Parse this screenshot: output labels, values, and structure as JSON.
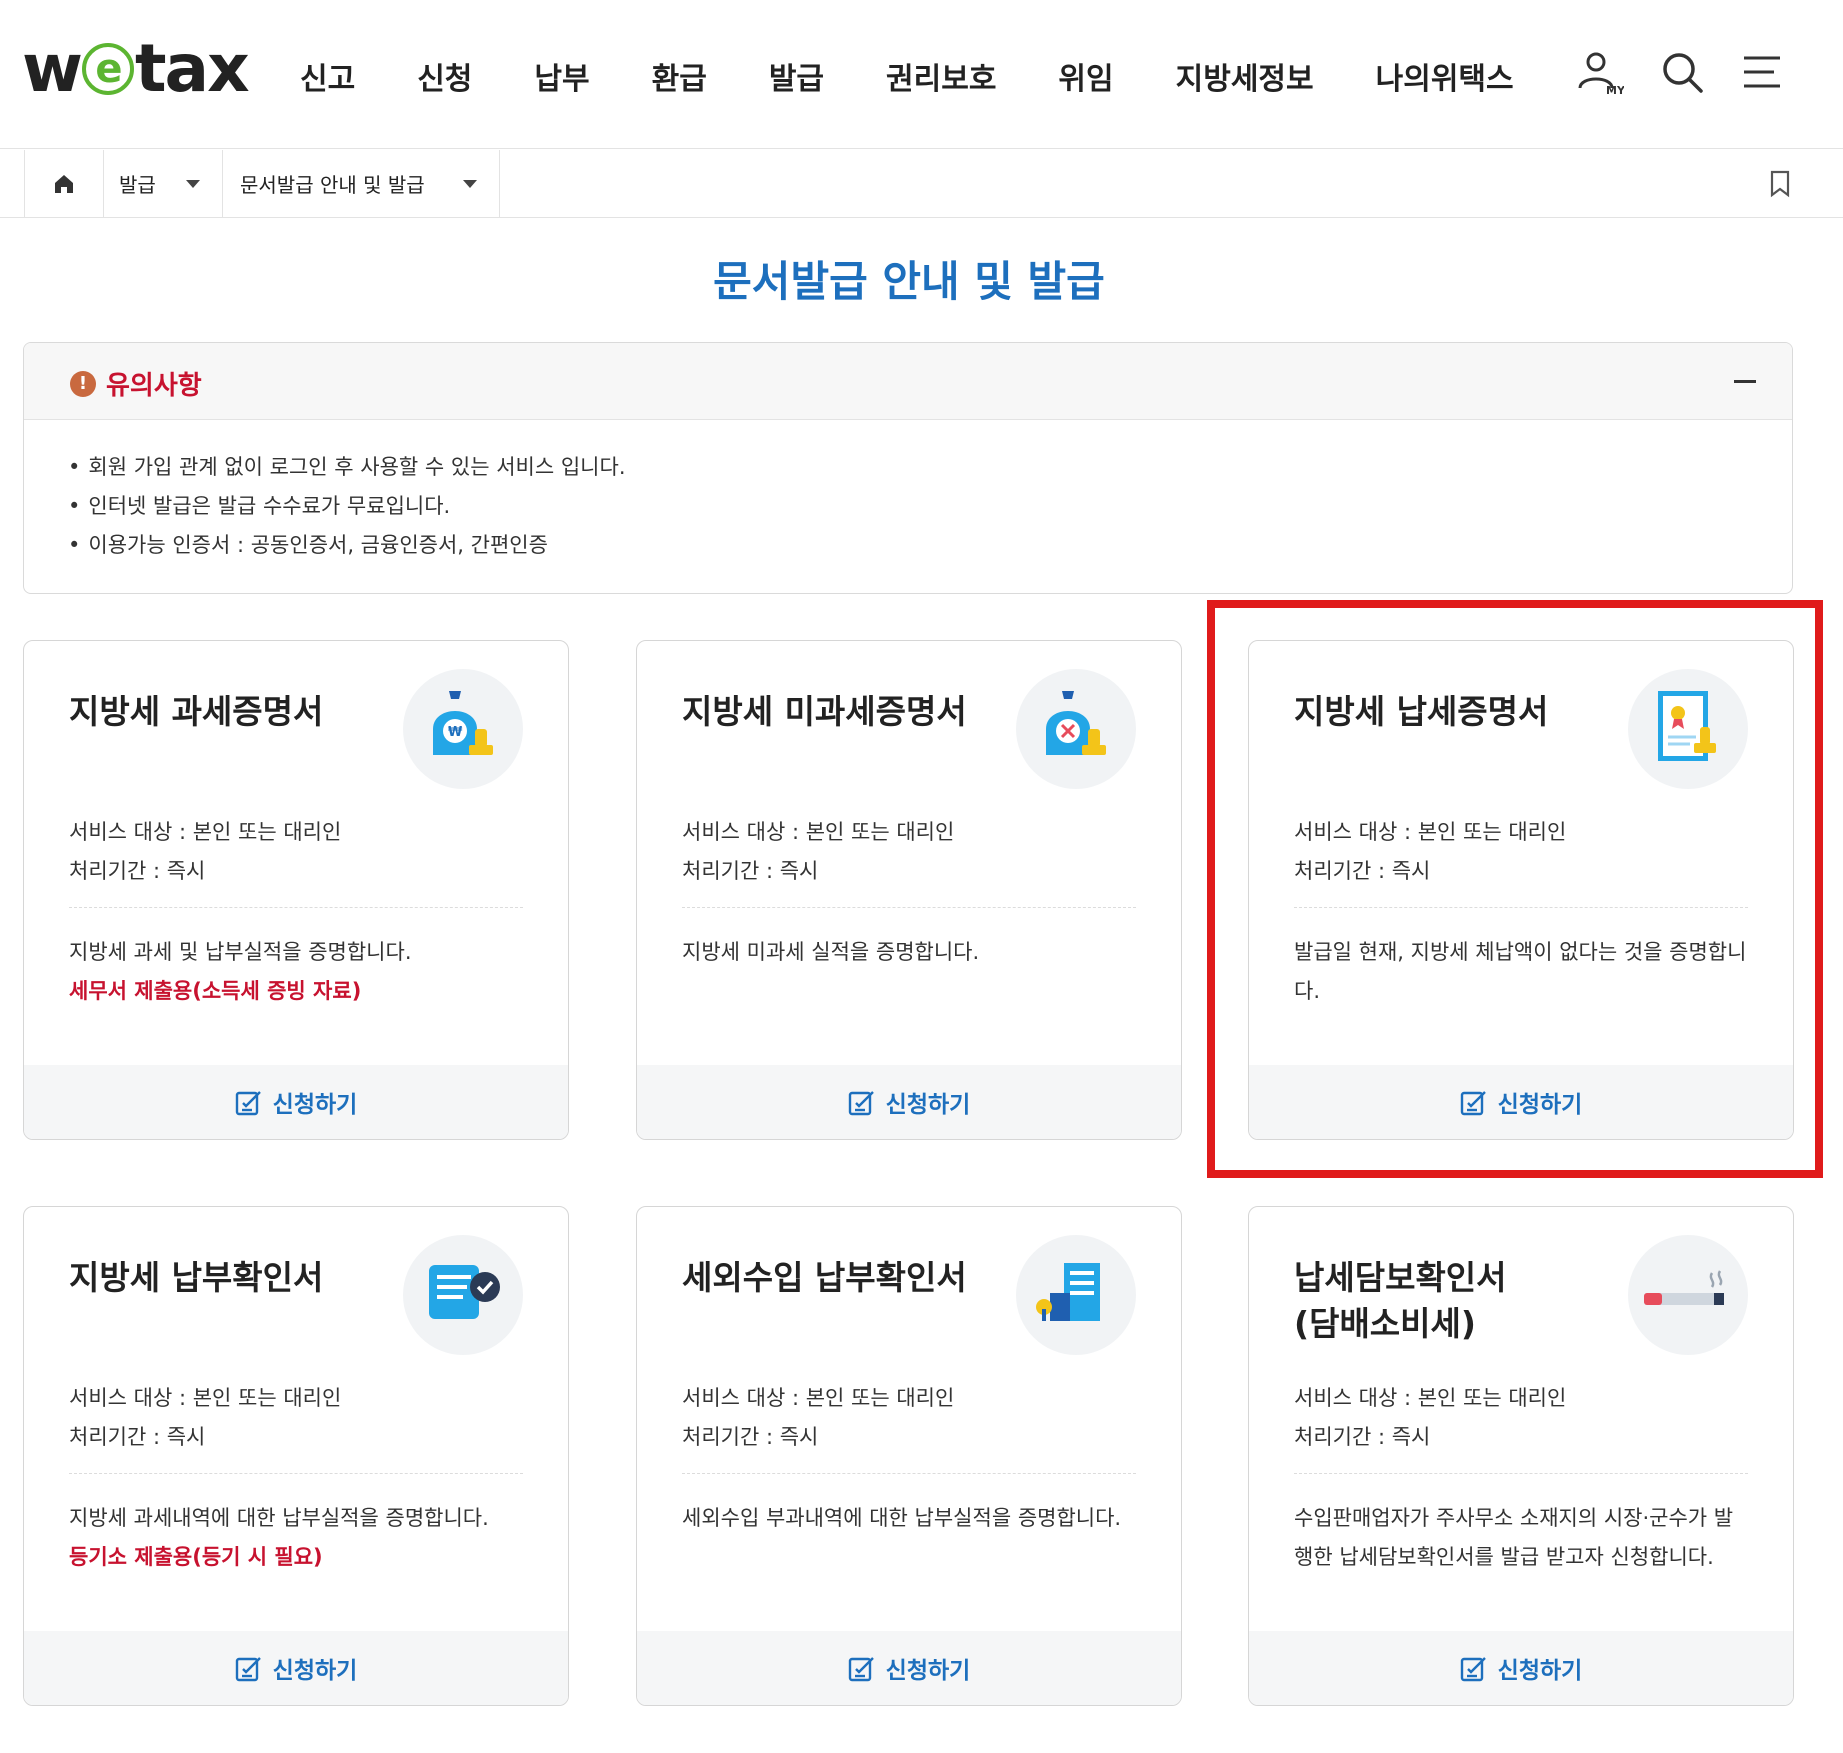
{
  "header": {
    "logo_text": "wetax",
    "nav": [
      "신고",
      "신청",
      "납부",
      "환급",
      "발급",
      "권리보호",
      "위임",
      "지방세정보",
      "나의위택스"
    ],
    "icons": [
      "my-user-icon",
      "search-icon",
      "menu-icon"
    ]
  },
  "breadcrumb": {
    "home_icon": "home-icon",
    "level1": "발급",
    "level2": "문서발급 안내 및 발급",
    "bookmark_icon": "bookmark-icon"
  },
  "page_title": "문서발급 안내 및 발급",
  "notice": {
    "title": "유의사항",
    "items": [
      "회원 가입 관계 없이 로그인 후 사용할 수 있는 서비스 입니다.",
      "인터넷 발급은 발급 수수료가 무료입니다.",
      "이용가능 인증서 : 공동인증서, 금융인증서, 간편인증"
    ]
  },
  "cards": [
    {
      "title": "지방세 과세증명서",
      "target": "서비스 대상 : 본인 또는 대리인",
      "period": "처리기간 : 즉시",
      "desc": "지방세 과세 및 납부실적을 증명합니다.",
      "note": "세무서 제출용(소득세 증빙 자료)",
      "apply": "신청하기",
      "icon": "tax-bag-icon"
    },
    {
      "title": "지방세 미과세증명서",
      "target": "서비스 대상 : 본인 또는 대리인",
      "period": "처리기간 : 즉시",
      "desc": "지방세 미과세 실적을 증명합니다.",
      "note": "",
      "apply": "신청하기",
      "icon": "no-tax-bag-icon"
    },
    {
      "title": "지방세 납세증명서",
      "target": "서비스 대상 : 본인 또는 대리인",
      "period": "처리기간 : 즉시",
      "desc": "발급일 현재, 지방세 체납액이 없다는 것을 증명합니다.",
      "note": "",
      "apply": "신청하기",
      "icon": "certificate-icon"
    },
    {
      "title": "지방세 납부확인서",
      "target": "서비스 대상 : 본인 또는 대리인",
      "period": "처리기간 : 즉시",
      "desc": "지방세 과세내역에 대한 납부실적을 증명합니다.",
      "note": "등기소 제출용(등기 시 필요)",
      "apply": "신청하기",
      "icon": "scroll-check-icon"
    },
    {
      "title": "세외수입 납부확인서",
      "target": "서비스 대상 : 본인 또는 대리인",
      "period": "처리기간 : 즉시",
      "desc": "세외수입 부과내역에 대한 납부실적을 증명합니다.",
      "note": "",
      "apply": "신청하기",
      "icon": "building-icon"
    },
    {
      "title": "납세담보확인서\n(담배소비세)",
      "target": "서비스 대상 : 본인 또는 대리인",
      "period": "처리기간 : 즉시",
      "desc": "수입판매업자가 주사무소 소재지의 시장·군수가 발행한 납세담보확인서를 발급 받고자 신청합니다.",
      "note": "",
      "apply": "신청하기",
      "icon": "cigarette-icon"
    }
  ],
  "colors": {
    "accent": "#1d6fbd",
    "alert": "#c7122f",
    "highlight": "#e01b1b",
    "logo_green": "#5cb531"
  }
}
